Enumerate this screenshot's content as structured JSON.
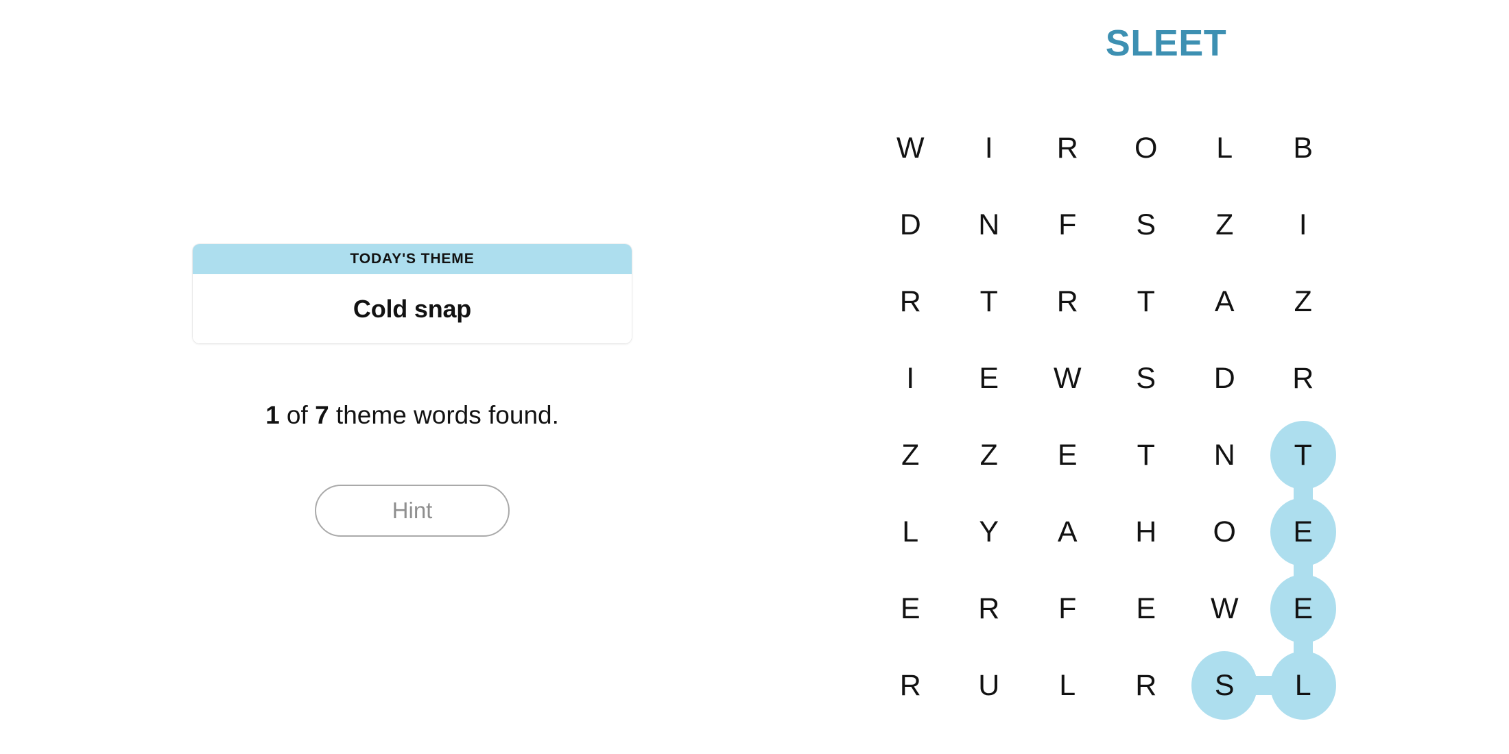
{
  "left": {
    "theme_card": {
      "header_label": "TODAY'S THEME",
      "theme_text": "Cold snap"
    },
    "progress": {
      "found_count": "1",
      "mid_text": " of ",
      "total_count": "7",
      "suffix_text": " theme words found."
    },
    "hint_button_label": "Hint"
  },
  "right": {
    "found_word_title": "SLEET",
    "grid": {
      "rows": 8,
      "cols": 6,
      "letters": [
        [
          "W",
          "I",
          "R",
          "O",
          "L",
          "B"
        ],
        [
          "D",
          "N",
          "F",
          "S",
          "Z",
          "I"
        ],
        [
          "R",
          "T",
          "R",
          "T",
          "A",
          "Z"
        ],
        [
          "I",
          "E",
          "W",
          "S",
          "D",
          "R"
        ],
        [
          "Z",
          "Z",
          "E",
          "T",
          "N",
          "T"
        ],
        [
          "L",
          "Y",
          "A",
          "H",
          "O",
          "E"
        ],
        [
          "E",
          "R",
          "F",
          "E",
          "W",
          "E"
        ],
        [
          "R",
          "U",
          "L",
          "R",
          "S",
          "L"
        ]
      ],
      "highlighted_cells": [
        {
          "row": 4,
          "col": 5,
          "letter": "T"
        },
        {
          "row": 5,
          "col": 5,
          "letter": "E"
        },
        {
          "row": 6,
          "col": 5,
          "letter": "E"
        },
        {
          "row": 7,
          "col": 5,
          "letter": "L"
        },
        {
          "row": 7,
          "col": 4,
          "letter": "S"
        }
      ],
      "highlight_word": "SLEET",
      "highlight_color": "#addeee"
    }
  },
  "colors": {
    "accent_blue": "#addeee",
    "title_teal": "#3d90b2",
    "text_dark": "#121212",
    "hint_border": "#a9a9a9",
    "hint_text": "#8f8f8f"
  }
}
